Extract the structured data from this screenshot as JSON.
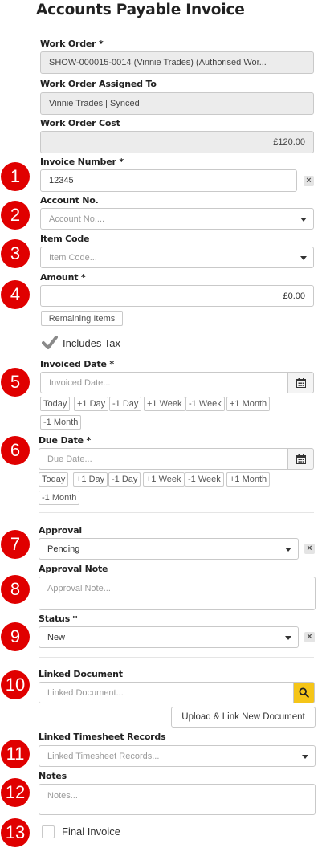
{
  "page": {
    "title": "Accounts Payable Invoice"
  },
  "work_order": {
    "label": "Work Order *",
    "value": "SHOW-000015-0014 (Vinnie Trades) (Authorised Wor..."
  },
  "assigned_to": {
    "label": "Work Order Assigned To",
    "value": "Vinnie Trades | Synced"
  },
  "cost": {
    "label": "Work Order Cost",
    "value": "£120.00"
  },
  "invoice_number": {
    "label": "Invoice Number *",
    "value": "12345"
  },
  "account_no": {
    "label": "Account No.",
    "placeholder": "Account No...."
  },
  "item_code": {
    "label": "Item Code",
    "placeholder": "Item Code..."
  },
  "amount": {
    "label": "Amount *",
    "value": "£0.00",
    "remaining_label": "Remaining Items"
  },
  "includes_tax": {
    "label": "Includes Tax",
    "checked": true
  },
  "invoiced_date": {
    "label": "Invoiced Date *",
    "placeholder": "Invoiced Date..."
  },
  "due_date": {
    "label": "Due Date *",
    "placeholder": "Due Date..."
  },
  "quick_dates": [
    "Today",
    "+1 Day",
    "-1 Day",
    "+1 Week",
    "-1 Week",
    "+1 Month",
    "-1 Month"
  ],
  "approval": {
    "label": "Approval",
    "value": "Pending"
  },
  "approval_note": {
    "label": "Approval Note",
    "placeholder": "Approval Note..."
  },
  "status": {
    "label": "Status *",
    "value": "New"
  },
  "linked_document": {
    "label": "Linked Document",
    "placeholder": "Linked Document...",
    "upload_label": "Upload & Link New Document"
  },
  "linked_timesheets": {
    "label": "Linked Timesheet Records",
    "placeholder": "Linked Timesheet Records..."
  },
  "notes": {
    "label": "Notes",
    "placeholder": "Notes..."
  },
  "final_invoice": {
    "label": "Final Invoice",
    "checked": false
  },
  "clear_symbol": "×",
  "badges": [
    "1",
    "2",
    "3",
    "4",
    "5",
    "6",
    "7",
    "8",
    "9",
    "10",
    "11",
    "12",
    "13"
  ],
  "colors": {
    "badge": "#e00000",
    "search_button": "#f5c518",
    "readonly_bg": "#ececec"
  },
  "icons": {
    "calendar": "calendar-icon",
    "search": "search-icon",
    "check": "check-icon",
    "clear": "clear-icon"
  }
}
